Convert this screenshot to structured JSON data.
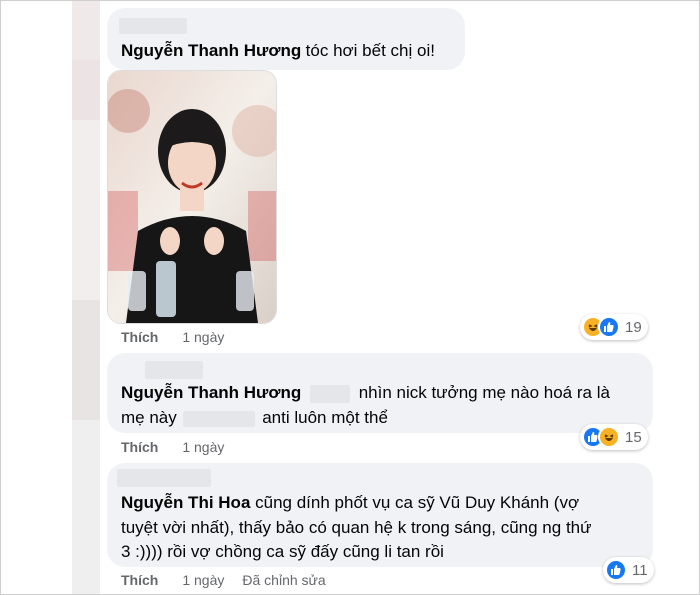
{
  "comments": [
    {
      "author": "Nguyễn Thanh Hương",
      "text": "tóc hơi bết chị oi!",
      "like_label": "Thích",
      "time": "1 ngày",
      "reaction_count": "19",
      "reaction_icons": [
        "haha-icon",
        "like-icon"
      ]
    },
    {
      "author": "Nguyễn Thanh Hương",
      "text_line1": "nhìn nick tưởng mẹ nào hoá ra là",
      "text_line2_a": "mẹ này",
      "text_line2_b": "anti luôn một thể",
      "like_label": "Thích",
      "time": "1 ngày",
      "reaction_count": "15",
      "reaction_icons": [
        "like-icon",
        "haha-icon"
      ]
    },
    {
      "author": "Nguyễn Thi Hoa",
      "text_line1": "cũng dính phốt vụ ca sỹ Vũ Duy Khánh (vợ",
      "text_line2": "tuyệt vời nhất), thấy bảo có quan hệ k trong sáng, cũng ng thứ",
      "text_line3": "3 :)))) rồi vợ chồng ca sỹ đấy cũng li tan rồi",
      "like_label": "Thích",
      "time": "1 ngày",
      "edited": "Đã chỉnh sửa",
      "reaction_count": "11",
      "reaction_icons": [
        "like-icon"
      ]
    }
  ],
  "colors": {
    "bubble": "#f0f2f5",
    "meta": "#65676b",
    "like_blue": "#1877f2",
    "haha_yellow": "#f7b125"
  }
}
